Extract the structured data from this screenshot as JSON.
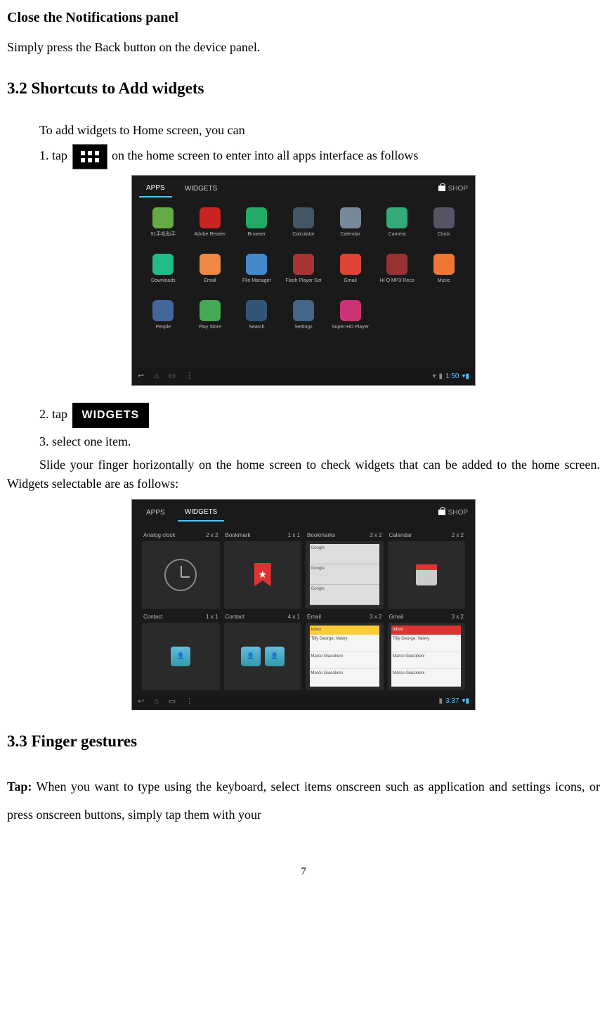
{
  "section_close": {
    "title": "Close the Notifications panel",
    "body": "Simply press the Back button on the device panel."
  },
  "section_3_2": {
    "title": "3.2 Shortcuts to Add widgets",
    "intro": "To add widgets to Home screen, you can",
    "step1_a": "1. tap",
    "step1_b": " on the home screen to enter into all apps interface as follows",
    "step2_a": "2. tap",
    "widgets_btn": "WIDGETS",
    "step3": "3. select one item.",
    "slide": "Slide your finger horizontally on the home screen to check widgets that can be added to the home screen. Widgets selectable are as follows:"
  },
  "screenshot1": {
    "tabs": {
      "apps": "APPS",
      "widgets": "WIDGETS"
    },
    "shop": "SHOP",
    "clock": "1:50",
    "apps": [
      {
        "label": "91手机助手",
        "color": "#6a4"
      },
      {
        "label": "Adobe Reader",
        "color": "#c22"
      },
      {
        "label": "Browser",
        "color": "#2a6"
      },
      {
        "label": "Calculator",
        "color": "#456"
      },
      {
        "label": "Calendar",
        "color": "#789"
      },
      {
        "label": "Camera",
        "color": "#3a7"
      },
      {
        "label": "Clock",
        "color": "#556"
      },
      {
        "label": "Downloads",
        "color": "#2b8"
      },
      {
        "label": "Email",
        "color": "#e84"
      },
      {
        "label": "File Manager",
        "color": "#48c"
      },
      {
        "label": "Flash Player Set",
        "color": "#a33"
      },
      {
        "label": "Gmail",
        "color": "#d43"
      },
      {
        "label": "Hi-Q MP3 Reco",
        "color": "#933"
      },
      {
        "label": "Music",
        "color": "#e73"
      },
      {
        "label": "People",
        "color": "#469"
      },
      {
        "label": "Play Store",
        "color": "#4a5"
      },
      {
        "label": "Search",
        "color": "#357"
      },
      {
        "label": "Settings",
        "color": "#468"
      },
      {
        "label": "Super-HD Player",
        "color": "#c37"
      }
    ]
  },
  "screenshot2": {
    "tabs": {
      "apps": "APPS",
      "widgets": "WIDGETS"
    },
    "shop": "SHOP",
    "clock": "3:37",
    "widgets": [
      {
        "name": "Analog clock",
        "size": "2 x 2",
        "type": "clock"
      },
      {
        "name": "Bookmark",
        "size": "1 x 1",
        "type": "bookmark"
      },
      {
        "name": "Bookmarks",
        "size": "3 x 2",
        "type": "bookmarks"
      },
      {
        "name": "Calendar",
        "size": "2 x 2",
        "type": "calendar"
      },
      {
        "name": "Contact",
        "size": "1 x 1",
        "type": "contact"
      },
      {
        "name": "Contact",
        "size": "4 x 1",
        "type": "contact-wide"
      },
      {
        "name": "Email",
        "size": "3 x 2",
        "type": "email"
      },
      {
        "name": "Gmail",
        "size": "3 x 2",
        "type": "email2"
      }
    ]
  },
  "section_3_3": {
    "title": "3.3 Finger gestures",
    "tap_label": "Tap:",
    "tap_body": " When you want to type using the keyboard, select items onscreen such as application and settings icons, or press onscreen buttons, simply tap them with your"
  },
  "page_number": "7"
}
